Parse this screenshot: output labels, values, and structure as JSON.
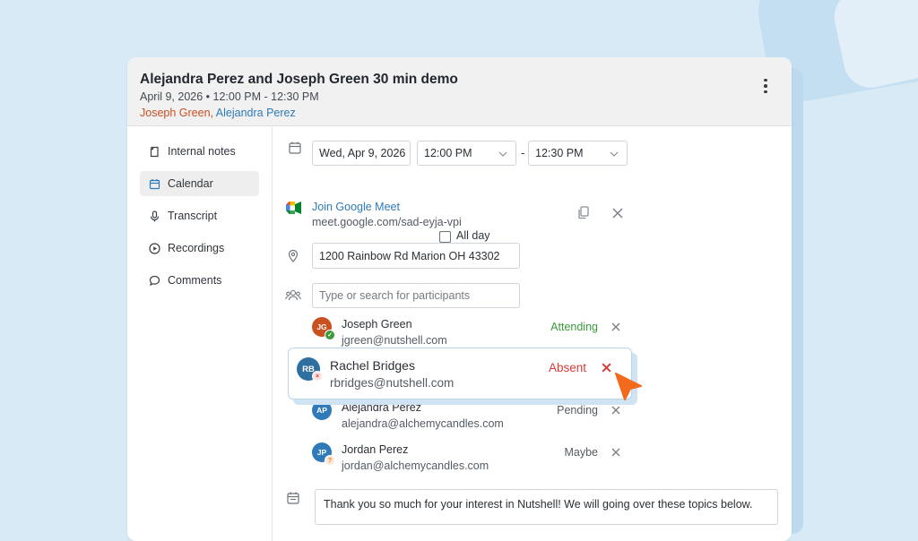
{
  "event": {
    "title": "Alejandra Perez and Joseph Green 30 min demo",
    "datetime": "April 9, 2026 • 12:00 PM - 12:30 PM",
    "name_1": "Joseph Green,",
    "name_2": "Alejandra Perez"
  },
  "sidebar": {
    "items": [
      {
        "label": "Internal notes",
        "icon": "note-icon"
      },
      {
        "label": "Calendar",
        "icon": "calendar-icon",
        "active": true
      },
      {
        "label": "Transcript",
        "icon": "microphone-icon"
      },
      {
        "label": "Recordings",
        "icon": "play-circle-icon"
      },
      {
        "label": "Comments",
        "icon": "comment-icon"
      }
    ]
  },
  "schedule": {
    "date": "Wed, Apr 9, 2026",
    "start_time": "12:00 PM",
    "separator": "-",
    "end_time": "12:30 PM",
    "all_day_label": "All day",
    "all_day_checked": false
  },
  "meeting": {
    "link_label": "Join Google Meet",
    "link_url": "meet.google.com/sad-eyja-vpi"
  },
  "location": {
    "value": "1200 Rainbow Rd Marion OH 43302"
  },
  "participants": {
    "search_placeholder": "Type or search for participants",
    "list": [
      {
        "initials": "JG",
        "name": "Joseph Green",
        "email": "jgreen@nutshell.com",
        "status": "Attending",
        "status_color": "#3a9a3a",
        "avatar_color": "#c9501f",
        "badge": "check"
      },
      {
        "initials": "RB",
        "name": "Rachel Bridges",
        "email": "rbridges@nutshell.com",
        "status": "Absent",
        "status_color": "#d63a3a",
        "avatar_color": "#2f6f9f",
        "badge": "x"
      },
      {
        "initials": "AP",
        "name": "Alejandra Perez",
        "email": "alejandra@alchemycandles.com",
        "status": "Pending",
        "status_color": "#555b63",
        "avatar_color": "#2f7ab8",
        "badge": "none"
      },
      {
        "initials": "JP",
        "name": "Jordan Perez",
        "email": "jordan@alchemycandles.com",
        "status": "Maybe",
        "status_color": "#555b63",
        "avatar_color": "#2f7ab8",
        "badge": "question"
      }
    ]
  },
  "notes": {
    "text": "Thank you so much for your interest in Nutshell! We will going over these topics below."
  },
  "colors": {
    "accent_blue": "#2f7ab8",
    "accent_orange": "#c9501f",
    "cursor_orange": "#f26a1b",
    "absent_red": "#d63a3a",
    "attending_green": "#3a9a3a"
  }
}
